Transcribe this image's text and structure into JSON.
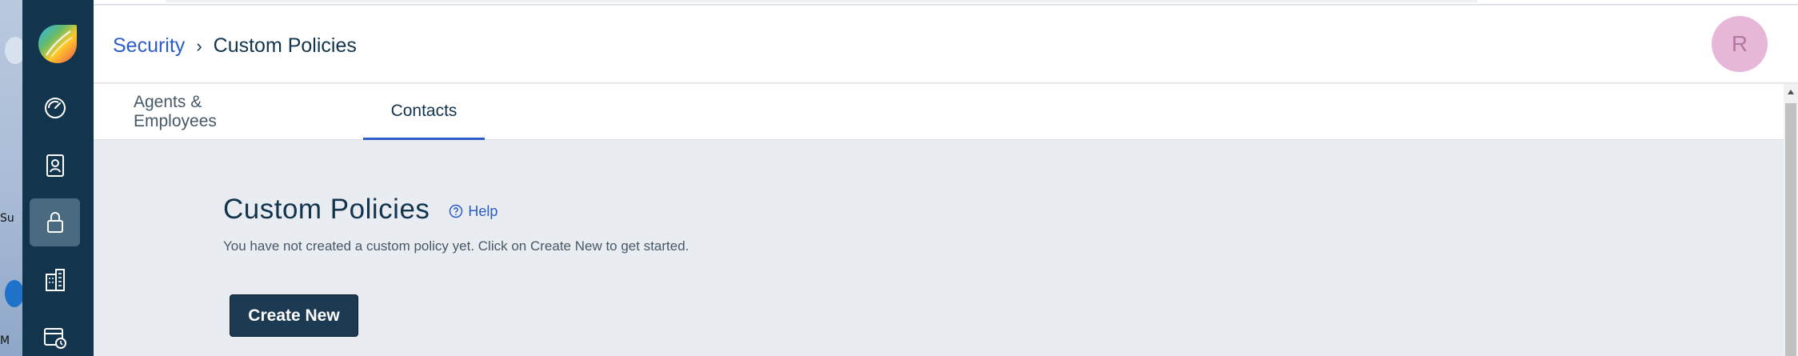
{
  "desktop": {
    "label_fragment_1": "Su",
    "label_fragment_2": "M"
  },
  "sidebar": {
    "items": [
      {
        "icon": "dashboard-icon",
        "active": false
      },
      {
        "icon": "contact-card-icon",
        "active": false
      },
      {
        "icon": "lock-icon",
        "active": true
      },
      {
        "icon": "building-icon",
        "active": false
      },
      {
        "icon": "calendar-clock-icon",
        "active": false
      }
    ]
  },
  "header": {
    "breadcrumb": {
      "parent": "Security",
      "separator": "›",
      "current": "Custom Policies"
    },
    "avatar_initial": "R"
  },
  "tabs": [
    {
      "label": "Agents & Employees",
      "active": false
    },
    {
      "label": "Contacts",
      "active": true
    }
  ],
  "main": {
    "title": "Custom Policies",
    "help_label": "Help",
    "empty_message": "You have not created a custom policy yet. Click on Create New to get started.",
    "create_button_label": "Create New"
  },
  "colors": {
    "sidebar_bg": "#12344d",
    "accent": "#2c5cc5",
    "content_bg": "#e9ecf1",
    "avatar_bg": "#e7b7d8",
    "button_bg": "#1c3a52"
  }
}
